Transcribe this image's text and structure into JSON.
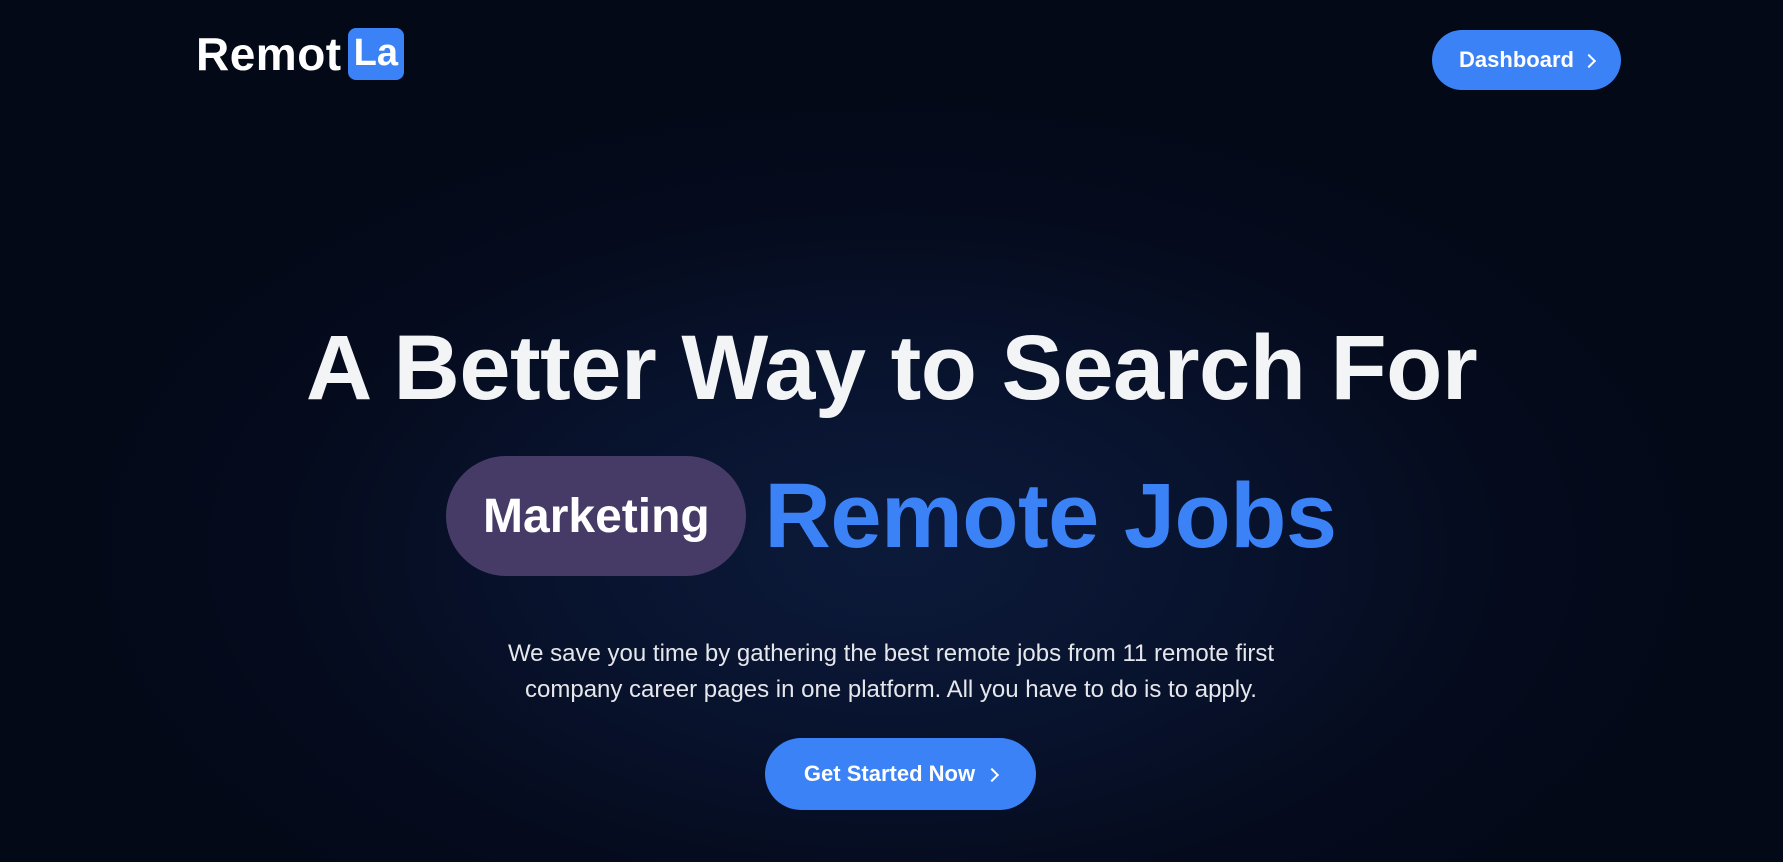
{
  "header": {
    "logo_text": "Remot",
    "logo_badge": "La",
    "dashboard_label": "Dashboard",
    "dashboard_icon": "chevron-right-icon"
  },
  "hero": {
    "headline": "A Better Way to Search For",
    "category_pill": "Marketing",
    "accent_text": "Remote Jobs",
    "description_line1": "We save you time by gathering the best remote jobs from 11 remote first",
    "description_line2": "company career pages in one platform. All you have to do is to apply.",
    "cta_label": "Get Started Now",
    "cta_icon": "chevron-right-icon"
  },
  "colors": {
    "background": "#050b1d",
    "accent": "#3b82f6",
    "pill": "#463b66",
    "text": "#f3f4f6"
  }
}
